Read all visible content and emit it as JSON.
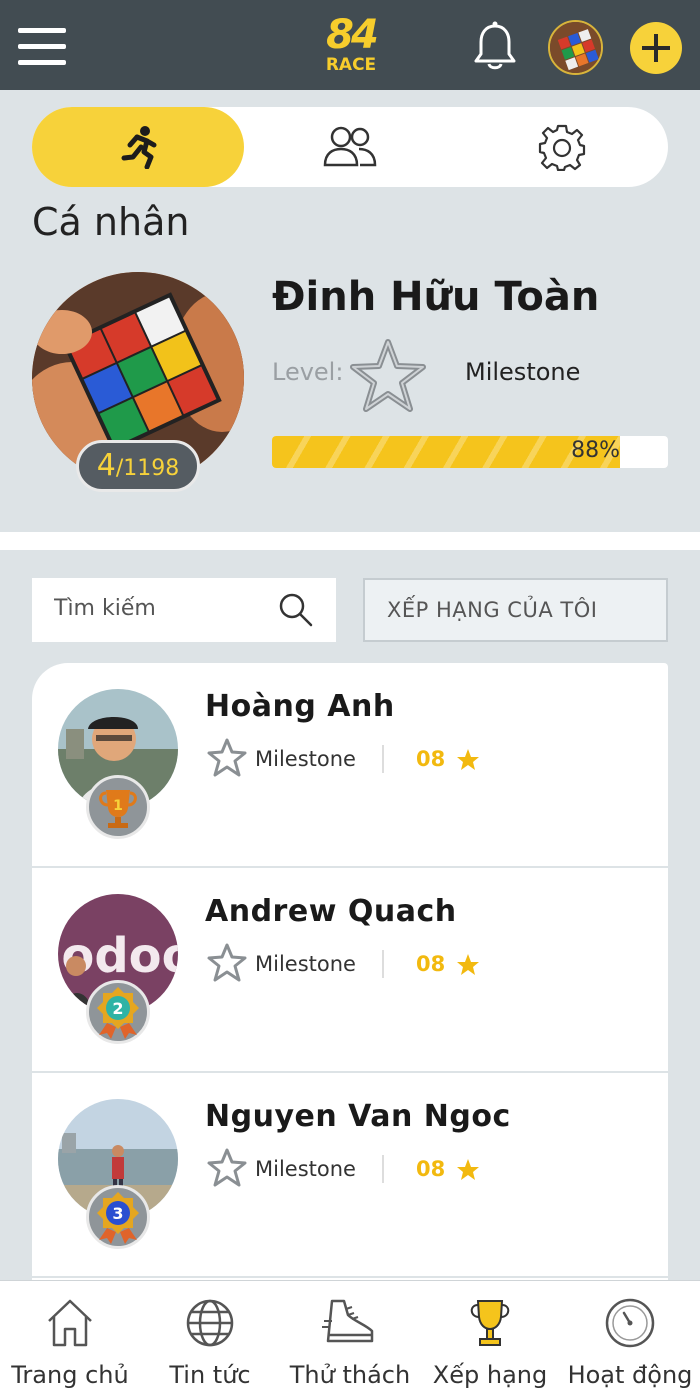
{
  "header": {
    "logo_number": "84",
    "logo_text": "RACE",
    "accent": "#f7d23a",
    "bar_color": "#424c52"
  },
  "tabs": [
    {
      "icon": "runner-icon",
      "active": true
    },
    {
      "icon": "group-icon",
      "active": false
    },
    {
      "icon": "gear-icon",
      "active": false
    }
  ],
  "section_title": "Cá nhân",
  "profile": {
    "name": "Đinh Hữu Toàn",
    "rank": "4",
    "rank_total": "/1198",
    "level_label": "Level:",
    "level_name": "Milestone",
    "progress_text": "88%",
    "progress_value": 0.88
  },
  "search": {
    "placeholder": "Tìm kiếm",
    "my_rank_label": "XẾP HẠNG CỦA TÔI"
  },
  "leaderboard": [
    {
      "name": "Hoàng Anh",
      "level": "Milestone",
      "points": "08",
      "medal": "1"
    },
    {
      "name": "Andrew Quach",
      "level": "Milestone",
      "points": "08",
      "medal": "2"
    },
    {
      "name": "Nguyen Van Ngoc",
      "level": "Milestone",
      "points": "08",
      "medal": "3"
    }
  ],
  "bottom_nav": [
    {
      "label": "Trang chủ",
      "icon": "home-icon",
      "active": false
    },
    {
      "label": "Tin tức",
      "icon": "globe-icon",
      "active": false
    },
    {
      "label": "Thử thách",
      "icon": "shoe-icon",
      "active": false
    },
    {
      "label": "Xếp hạng",
      "icon": "trophy-icon",
      "active": true
    },
    {
      "label": "Hoạt động",
      "icon": "speedometer-icon",
      "active": false
    }
  ]
}
